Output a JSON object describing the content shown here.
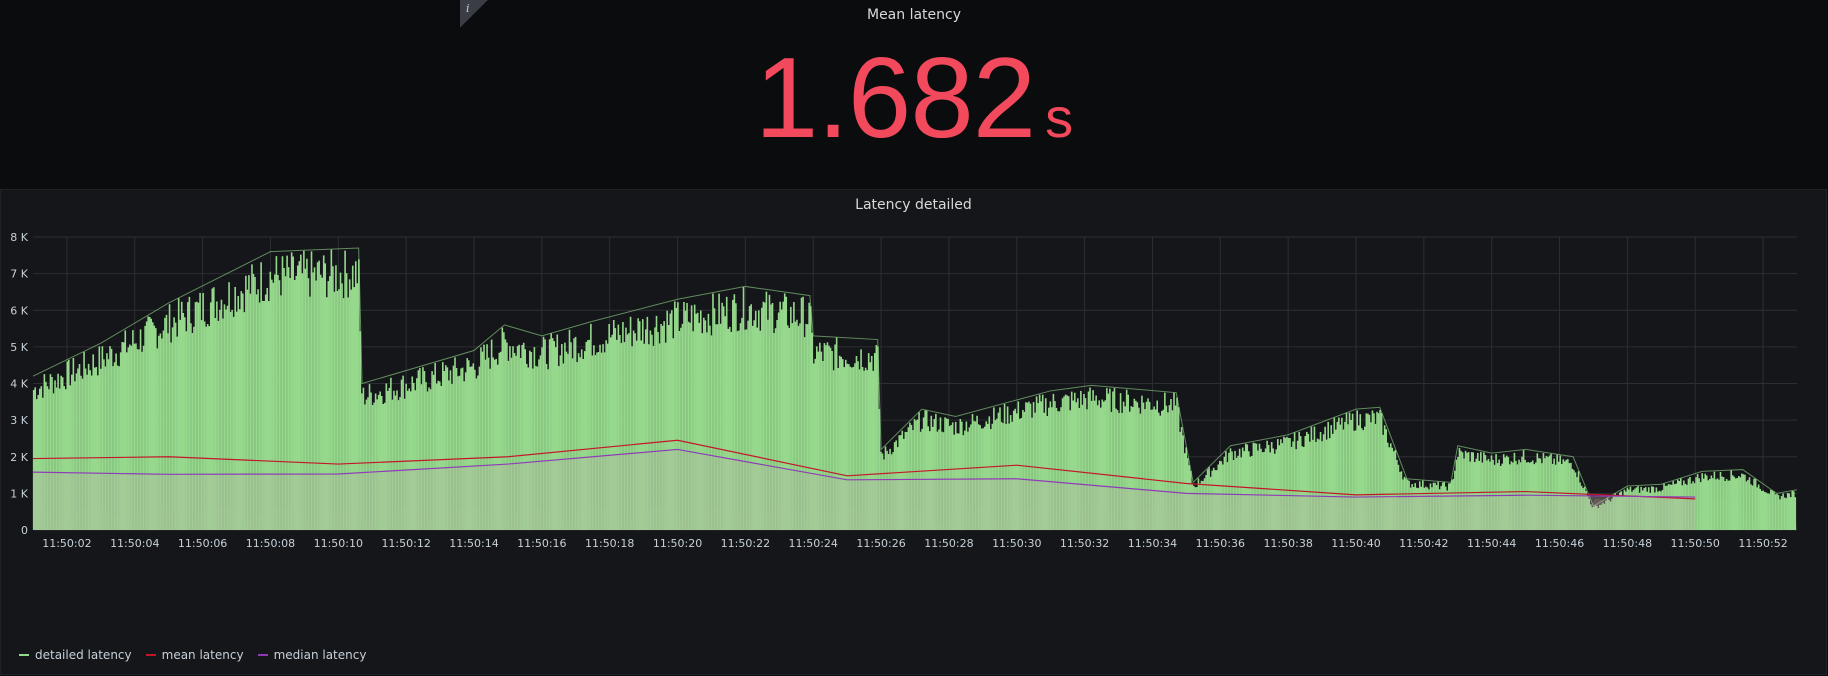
{
  "stat_panel": {
    "title": "Mean latency",
    "value": "1.682",
    "unit": "s",
    "value_color": "#f2495c",
    "info_icon_glyph": "i"
  },
  "graph_panel": {
    "title": "Latency detailed",
    "legend": [
      {
        "label": "detailed latency",
        "color": "#96d98d"
      },
      {
        "label": "mean latency",
        "color": "#c4162a"
      },
      {
        "label": "median latency",
        "color": "#8f3bb8"
      }
    ]
  },
  "chart_data": {
    "type": "area",
    "title": "Latency detailed",
    "xlabel": "",
    "ylabel": "",
    "ylim": [
      0,
      8000
    ],
    "xlim_seconds": [
      "11:50:01",
      "11:50:53"
    ],
    "grid": true,
    "legend_position": "bottom-left",
    "y_ticks": [
      "0",
      "1 K",
      "2 K",
      "3 K",
      "4 K",
      "5 K",
      "6 K",
      "7 K",
      "8 K"
    ],
    "x_ticks": [
      "11:50:02",
      "11:50:04",
      "11:50:06",
      "11:50:08",
      "11:50:10",
      "11:50:12",
      "11:50:14",
      "11:50:16",
      "11:50:18",
      "11:50:20",
      "11:50:22",
      "11:50:24",
      "11:50:26",
      "11:50:28",
      "11:50:30",
      "11:50:32",
      "11:50:34",
      "11:50:36",
      "11:50:38",
      "11:50:40",
      "11:50:42",
      "11:50:44",
      "11:50:46",
      "11:50:48",
      "11:50:50",
      "11:50:52"
    ],
    "series": [
      {
        "name": "detailed latency",
        "color": "#96d98d",
        "style": "dense-spikes",
        "envelope": [
          {
            "t": "11:50:01.0",
            "v": 4200
          },
          {
            "t": "11:50:03.0",
            "v": 5100
          },
          {
            "t": "11:50:05.0",
            "v": 6200
          },
          {
            "t": "11:50:08.0",
            "v": 7600
          },
          {
            "t": "11:50:10.6",
            "v": 7700
          },
          {
            "t": "11:50:10.7",
            "v": 4000
          },
          {
            "t": "11:50:14.0",
            "v": 4900
          },
          {
            "t": "11:50:14.9",
            "v": 5600
          },
          {
            "t": "11:50:16.0",
            "v": 5300
          },
          {
            "t": "11:50:17.5",
            "v": 5700
          },
          {
            "t": "11:50:20.0",
            "v": 6300
          },
          {
            "t": "11:50:22.0",
            "v": 6650
          },
          {
            "t": "11:50:23.9",
            "v": 6400
          },
          {
            "t": "11:50:24.0",
            "v": 5300
          },
          {
            "t": "11:50:25.9",
            "v": 5200
          },
          {
            "t": "11:50:26.0",
            "v": 2200
          },
          {
            "t": "11:50:27.2",
            "v": 3300
          },
          {
            "t": "11:50:28.2",
            "v": 3100
          },
          {
            "t": "11:50:31.0",
            "v": 3800
          },
          {
            "t": "11:50:32.2",
            "v": 3950
          },
          {
            "t": "11:50:34.7",
            "v": 3750
          },
          {
            "t": "11:50:35.2",
            "v": 1300
          },
          {
            "t": "11:50:36.3",
            "v": 2300
          },
          {
            "t": "11:50:38.0",
            "v": 2600
          },
          {
            "t": "11:50:40.0",
            "v": 3300
          },
          {
            "t": "11:50:40.7",
            "v": 3350
          },
          {
            "t": "11:50:41.5",
            "v": 1400
          },
          {
            "t": "11:50:42.8",
            "v": 1300
          },
          {
            "t": "11:50:43.0",
            "v": 2300
          },
          {
            "t": "11:50:44.0",
            "v": 2100
          },
          {
            "t": "11:50:45.0",
            "v": 2200
          },
          {
            "t": "11:50:46.4",
            "v": 2000
          },
          {
            "t": "11:50:47.0",
            "v": 650
          },
          {
            "t": "11:50:48.0",
            "v": 1200
          },
          {
            "t": "11:50:49.0",
            "v": 1250
          },
          {
            "t": "11:50:50.2",
            "v": 1600
          },
          {
            "t": "11:50:51.4",
            "v": 1650
          },
          {
            "t": "11:50:52.4",
            "v": 1000
          },
          {
            "t": "11:50:53.0",
            "v": 1100
          }
        ]
      },
      {
        "name": "mean latency",
        "color": "#c4162a",
        "points": [
          {
            "t": "11:50:01.0",
            "v": 1950
          },
          {
            "t": "11:50:05.0",
            "v": 2000
          },
          {
            "t": "11:50:10.0",
            "v": 1800
          },
          {
            "t": "11:50:15.0",
            "v": 2000
          },
          {
            "t": "11:50:20.0",
            "v": 2450
          },
          {
            "t": "11:50:25.0",
            "v": 1480
          },
          {
            "t": "11:50:30.0",
            "v": 1770
          },
          {
            "t": "11:50:35.0",
            "v": 1270
          },
          {
            "t": "11:50:40.0",
            "v": 960
          },
          {
            "t": "11:50:45.0",
            "v": 1050
          },
          {
            "t": "11:50:50.0",
            "v": 850
          }
        ]
      },
      {
        "name": "median latency",
        "color": "#8f3bb8",
        "points": [
          {
            "t": "11:50:01.0",
            "v": 1580
          },
          {
            "t": "11:50:05.0",
            "v": 1520
          },
          {
            "t": "11:50:10.0",
            "v": 1530
          },
          {
            "t": "11:50:15.0",
            "v": 1800
          },
          {
            "t": "11:50:20.0",
            "v": 2200
          },
          {
            "t": "11:50:25.0",
            "v": 1370
          },
          {
            "t": "11:50:30.0",
            "v": 1400
          },
          {
            "t": "11:50:35.0",
            "v": 1000
          },
          {
            "t": "11:50:40.0",
            "v": 900
          },
          {
            "t": "11:50:45.0",
            "v": 950
          },
          {
            "t": "11:50:50.0",
            "v": 900
          }
        ]
      }
    ]
  }
}
